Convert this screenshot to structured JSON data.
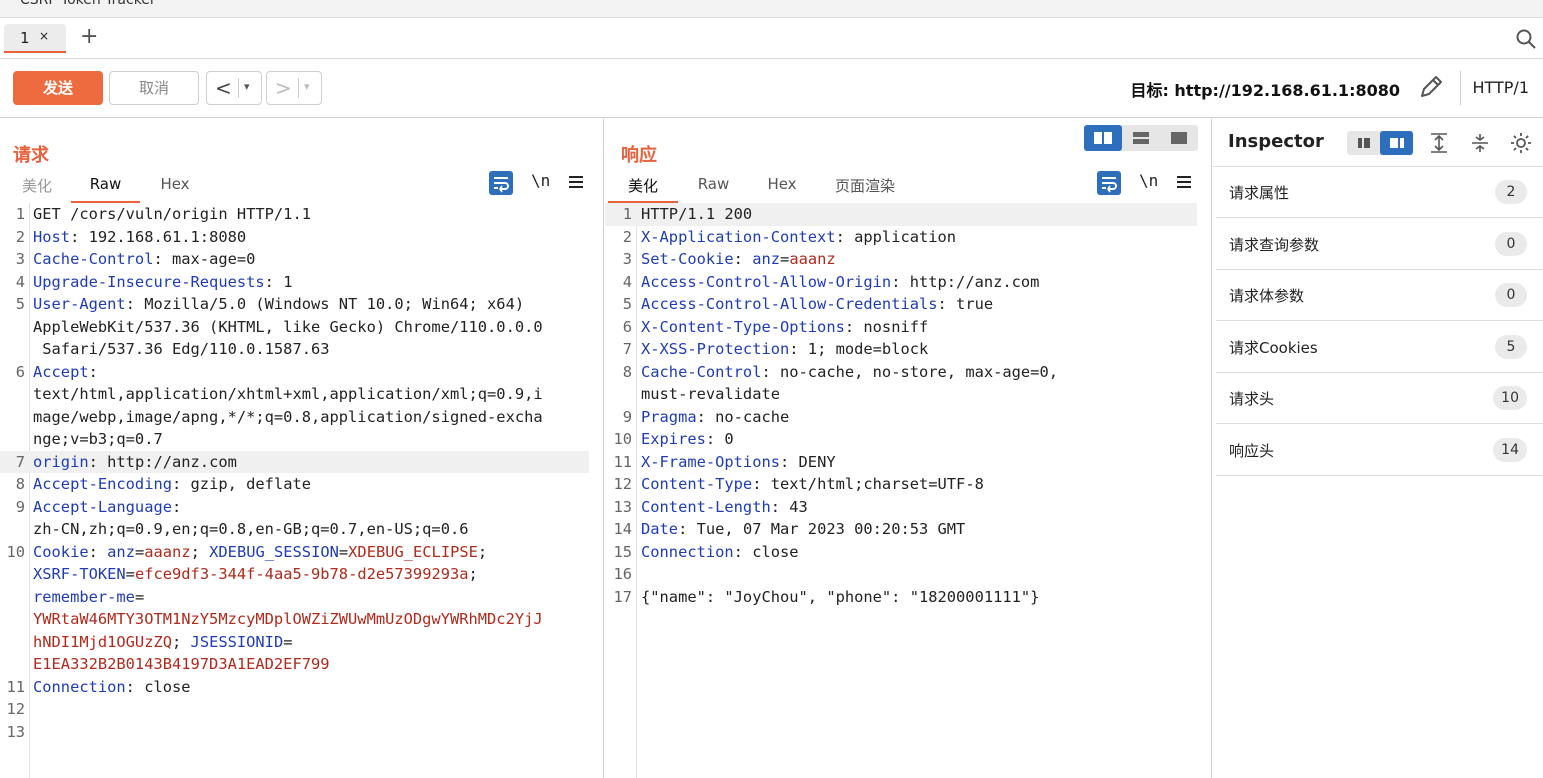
{
  "window": {
    "title": "CSRF Token Tracker"
  },
  "tabs": [
    {
      "label": "1",
      "close": "×"
    }
  ],
  "new_tab": "+",
  "toolbar": {
    "send": "发送",
    "cancel": "取消",
    "back": "<",
    "forward": ">",
    "dropdown": "▾",
    "target": "目标: http://192.168.61.1:8080",
    "http_version": "HTTP/1"
  },
  "request": {
    "title": "请求",
    "tabs": [
      "美化",
      "Raw",
      "Hex"
    ],
    "active_tab": "Raw",
    "newline_toggle": "\\n",
    "lines": [
      {
        "n": "1",
        "parts": [
          [
            "t",
            "GET /cors/vuln/origin HTTP/1.1"
          ]
        ]
      },
      {
        "n": "2",
        "parts": [
          [
            "k",
            "Host"
          ],
          [
            "t",
            ": 192.168.61.1:8080"
          ]
        ]
      },
      {
        "n": "3",
        "parts": [
          [
            "k",
            "Cache-Control"
          ],
          [
            "t",
            ": max-age=0"
          ]
        ]
      },
      {
        "n": "4",
        "parts": [
          [
            "k",
            "Upgrade-Insecure-Requests"
          ],
          [
            "t",
            ": 1"
          ]
        ]
      },
      {
        "n": "5",
        "parts": [
          [
            "k",
            "User-Agent"
          ],
          [
            "t",
            ": Mozilla/5.0 (Windows NT 10.0; Win64; x64)"
          ]
        ]
      },
      {
        "n": "",
        "parts": [
          [
            "t",
            "AppleWebKit/537.36 (KHTML, like Gecko) Chrome/110.0.0.0"
          ]
        ]
      },
      {
        "n": "",
        "parts": [
          [
            "t",
            " Safari/537.36 Edg/110.0.1587.63"
          ]
        ]
      },
      {
        "n": "6",
        "parts": [
          [
            "k",
            "Accept"
          ],
          [
            "t",
            ":"
          ]
        ]
      },
      {
        "n": "",
        "parts": [
          [
            "t",
            "text/html,application/xhtml+xml,application/xml;q=0.9,i"
          ]
        ]
      },
      {
        "n": "",
        "parts": [
          [
            "t",
            "mage/webp,image/apng,*/*;q=0.8,application/signed-excha"
          ]
        ]
      },
      {
        "n": "",
        "parts": [
          [
            "t",
            "nge;v=b3;q=0.7"
          ]
        ]
      },
      {
        "n": "7",
        "hl": true,
        "parts": [
          [
            "k",
            "origin"
          ],
          [
            "t",
            ": http://anz.com"
          ]
        ]
      },
      {
        "n": "8",
        "parts": [
          [
            "k",
            "Accept-Encoding"
          ],
          [
            "t",
            ": gzip, deflate"
          ]
        ]
      },
      {
        "n": "9",
        "parts": [
          [
            "k",
            "Accept-Language"
          ],
          [
            "t",
            ":"
          ]
        ]
      },
      {
        "n": "",
        "parts": [
          [
            "t",
            "zh-CN,zh;q=0.9,en;q=0.8,en-GB;q=0.7,en-US;q=0.6"
          ]
        ]
      },
      {
        "n": "10",
        "parts": [
          [
            "k",
            "Cookie"
          ],
          [
            "t",
            ": "
          ],
          [
            "k",
            "anz"
          ],
          [
            "t",
            "="
          ],
          [
            "v",
            "aaanz"
          ],
          [
            "t",
            "; "
          ],
          [
            "k",
            "XDEBUG_SESSION"
          ],
          [
            "t",
            "="
          ],
          [
            "v",
            "XDEBUG_ECLIPSE"
          ],
          [
            "t",
            ";"
          ]
        ]
      },
      {
        "n": "",
        "parts": [
          [
            "k",
            "XSRF-TOKEN"
          ],
          [
            "t",
            "="
          ],
          [
            "v",
            "efce9df3-344f-4aa5-9b78-d2e57399293a"
          ],
          [
            "t",
            ";"
          ]
        ]
      },
      {
        "n": "",
        "parts": [
          [
            "k",
            "remember-me"
          ],
          [
            "t",
            "="
          ]
        ]
      },
      {
        "n": "",
        "parts": [
          [
            "v",
            "YWRtaW46MTY3OTM1NzY5MzcyMDplOWZiZWUwMmUzODgwYWRhMDc2YjJ"
          ]
        ]
      },
      {
        "n": "",
        "parts": [
          [
            "v",
            "hNDI1Mjd1OGUzZQ"
          ],
          [
            "t",
            "; "
          ],
          [
            "k",
            "JSESSIONID"
          ],
          [
            "t",
            "="
          ]
        ]
      },
      {
        "n": "",
        "parts": [
          [
            "v",
            "E1EA332B2B0143B4197D3A1EAD2EF799"
          ]
        ]
      },
      {
        "n": "11",
        "parts": [
          [
            "k",
            "Connection"
          ],
          [
            "t",
            ": close"
          ]
        ]
      },
      {
        "n": "12",
        "parts": [
          [
            "t",
            ""
          ]
        ]
      },
      {
        "n": "13",
        "parts": [
          [
            "t",
            ""
          ]
        ]
      }
    ]
  },
  "response": {
    "title": "响应",
    "tabs": [
      "美化",
      "Raw",
      "Hex",
      "页面渲染"
    ],
    "active_tab": "美化",
    "newline_toggle": "\\n",
    "lines": [
      {
        "n": "1",
        "hl": true,
        "parts": [
          [
            "t",
            "HTTP/1.1 200"
          ]
        ]
      },
      {
        "n": "2",
        "parts": [
          [
            "k",
            "X-Application-Context"
          ],
          [
            "t",
            ": application"
          ]
        ]
      },
      {
        "n": "3",
        "parts": [
          [
            "k",
            "Set-Cookie"
          ],
          [
            "t",
            ": "
          ],
          [
            "k",
            "anz"
          ],
          [
            "t",
            "="
          ],
          [
            "v",
            "aaanz"
          ]
        ]
      },
      {
        "n": "4",
        "parts": [
          [
            "k",
            "Access-Control-Allow-Origin"
          ],
          [
            "t",
            ": http://anz.com"
          ]
        ]
      },
      {
        "n": "5",
        "parts": [
          [
            "k",
            "Access-Control-Allow-Credentials"
          ],
          [
            "t",
            ": true"
          ]
        ]
      },
      {
        "n": "6",
        "parts": [
          [
            "k",
            "X-Content-Type-Options"
          ],
          [
            "t",
            ": nosniff"
          ]
        ]
      },
      {
        "n": "7",
        "parts": [
          [
            "k",
            "X-XSS-Protection"
          ],
          [
            "t",
            ": 1; mode=block"
          ]
        ]
      },
      {
        "n": "8",
        "parts": [
          [
            "k",
            "Cache-Control"
          ],
          [
            "t",
            ": no-cache, no-store, max-age=0,"
          ]
        ]
      },
      {
        "n": "",
        "parts": [
          [
            "t",
            "must-revalidate"
          ]
        ]
      },
      {
        "n": "9",
        "parts": [
          [
            "k",
            "Pragma"
          ],
          [
            "t",
            ": no-cache"
          ]
        ]
      },
      {
        "n": "10",
        "parts": [
          [
            "k",
            "Expires"
          ],
          [
            "t",
            ": 0"
          ]
        ]
      },
      {
        "n": "11",
        "parts": [
          [
            "k",
            "X-Frame-Options"
          ],
          [
            "t",
            ": DENY"
          ]
        ]
      },
      {
        "n": "12",
        "parts": [
          [
            "k",
            "Content-Type"
          ],
          [
            "t",
            ": text/html;charset=UTF-8"
          ]
        ]
      },
      {
        "n": "13",
        "parts": [
          [
            "k",
            "Content-Length"
          ],
          [
            "t",
            ": 43"
          ]
        ]
      },
      {
        "n": "14",
        "parts": [
          [
            "k",
            "Date"
          ],
          [
            "t",
            ": Tue, 07 Mar 2023 00:20:53 GMT"
          ]
        ]
      },
      {
        "n": "15",
        "parts": [
          [
            "k",
            "Connection"
          ],
          [
            "t",
            ": close"
          ]
        ]
      },
      {
        "n": "16",
        "parts": [
          [
            "t",
            ""
          ]
        ]
      },
      {
        "n": "17",
        "parts": [
          [
            "t",
            "{\"name\": \"JoyChou\", \"phone\": \"18200001111\"}"
          ]
        ]
      }
    ]
  },
  "inspector": {
    "title": "Inspector",
    "rows": [
      {
        "label": "请求属性",
        "count": "2"
      },
      {
        "label": "请求查询参数",
        "count": "0"
      },
      {
        "label": "请求体参数",
        "count": "0"
      },
      {
        "label": "请求Cookies",
        "count": "5"
      },
      {
        "label": "请求头",
        "count": "10"
      },
      {
        "label": "响应头",
        "count": "14"
      }
    ]
  },
  "colors": {
    "accent": "#e8603c",
    "send": "#ee6a3f",
    "key": "#1f3cb5",
    "value": "#b02a1c",
    "blue": "#2d6ebd"
  }
}
